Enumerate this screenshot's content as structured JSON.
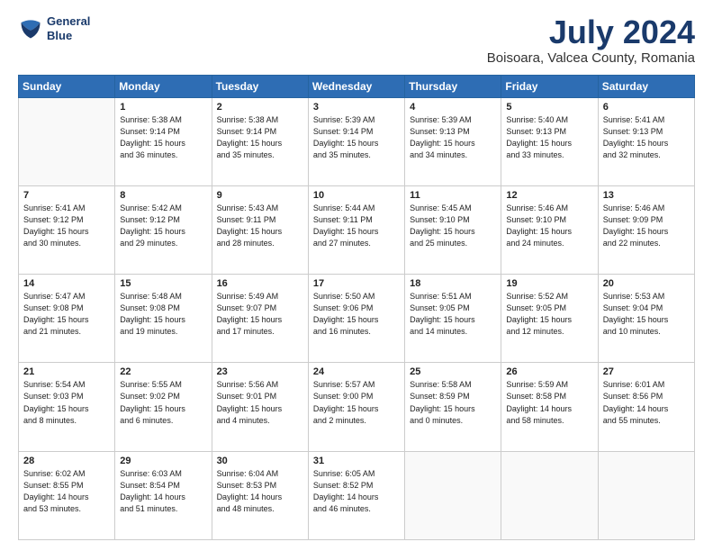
{
  "header": {
    "logo_line1": "General",
    "logo_line2": "Blue",
    "title": "July 2024",
    "subtitle": "Boisoara, Valcea County, Romania"
  },
  "weekdays": [
    "Sunday",
    "Monday",
    "Tuesday",
    "Wednesday",
    "Thursday",
    "Friday",
    "Saturday"
  ],
  "weeks": [
    [
      {
        "day": "",
        "info": ""
      },
      {
        "day": "1",
        "info": "Sunrise: 5:38 AM\nSunset: 9:14 PM\nDaylight: 15 hours\nand 36 minutes."
      },
      {
        "day": "2",
        "info": "Sunrise: 5:38 AM\nSunset: 9:14 PM\nDaylight: 15 hours\nand 35 minutes."
      },
      {
        "day": "3",
        "info": "Sunrise: 5:39 AM\nSunset: 9:14 PM\nDaylight: 15 hours\nand 35 minutes."
      },
      {
        "day": "4",
        "info": "Sunrise: 5:39 AM\nSunset: 9:13 PM\nDaylight: 15 hours\nand 34 minutes."
      },
      {
        "day": "5",
        "info": "Sunrise: 5:40 AM\nSunset: 9:13 PM\nDaylight: 15 hours\nand 33 minutes."
      },
      {
        "day": "6",
        "info": "Sunrise: 5:41 AM\nSunset: 9:13 PM\nDaylight: 15 hours\nand 32 minutes."
      }
    ],
    [
      {
        "day": "7",
        "info": "Sunrise: 5:41 AM\nSunset: 9:12 PM\nDaylight: 15 hours\nand 30 minutes."
      },
      {
        "day": "8",
        "info": "Sunrise: 5:42 AM\nSunset: 9:12 PM\nDaylight: 15 hours\nand 29 minutes."
      },
      {
        "day": "9",
        "info": "Sunrise: 5:43 AM\nSunset: 9:11 PM\nDaylight: 15 hours\nand 28 minutes."
      },
      {
        "day": "10",
        "info": "Sunrise: 5:44 AM\nSunset: 9:11 PM\nDaylight: 15 hours\nand 27 minutes."
      },
      {
        "day": "11",
        "info": "Sunrise: 5:45 AM\nSunset: 9:10 PM\nDaylight: 15 hours\nand 25 minutes."
      },
      {
        "day": "12",
        "info": "Sunrise: 5:46 AM\nSunset: 9:10 PM\nDaylight: 15 hours\nand 24 minutes."
      },
      {
        "day": "13",
        "info": "Sunrise: 5:46 AM\nSunset: 9:09 PM\nDaylight: 15 hours\nand 22 minutes."
      }
    ],
    [
      {
        "day": "14",
        "info": "Sunrise: 5:47 AM\nSunset: 9:08 PM\nDaylight: 15 hours\nand 21 minutes."
      },
      {
        "day": "15",
        "info": "Sunrise: 5:48 AM\nSunset: 9:08 PM\nDaylight: 15 hours\nand 19 minutes."
      },
      {
        "day": "16",
        "info": "Sunrise: 5:49 AM\nSunset: 9:07 PM\nDaylight: 15 hours\nand 17 minutes."
      },
      {
        "day": "17",
        "info": "Sunrise: 5:50 AM\nSunset: 9:06 PM\nDaylight: 15 hours\nand 16 minutes."
      },
      {
        "day": "18",
        "info": "Sunrise: 5:51 AM\nSunset: 9:05 PM\nDaylight: 15 hours\nand 14 minutes."
      },
      {
        "day": "19",
        "info": "Sunrise: 5:52 AM\nSunset: 9:05 PM\nDaylight: 15 hours\nand 12 minutes."
      },
      {
        "day": "20",
        "info": "Sunrise: 5:53 AM\nSunset: 9:04 PM\nDaylight: 15 hours\nand 10 minutes."
      }
    ],
    [
      {
        "day": "21",
        "info": "Sunrise: 5:54 AM\nSunset: 9:03 PM\nDaylight: 15 hours\nand 8 minutes."
      },
      {
        "day": "22",
        "info": "Sunrise: 5:55 AM\nSunset: 9:02 PM\nDaylight: 15 hours\nand 6 minutes."
      },
      {
        "day": "23",
        "info": "Sunrise: 5:56 AM\nSunset: 9:01 PM\nDaylight: 15 hours\nand 4 minutes."
      },
      {
        "day": "24",
        "info": "Sunrise: 5:57 AM\nSunset: 9:00 PM\nDaylight: 15 hours\nand 2 minutes."
      },
      {
        "day": "25",
        "info": "Sunrise: 5:58 AM\nSunset: 8:59 PM\nDaylight: 15 hours\nand 0 minutes."
      },
      {
        "day": "26",
        "info": "Sunrise: 5:59 AM\nSunset: 8:58 PM\nDaylight: 14 hours\nand 58 minutes."
      },
      {
        "day": "27",
        "info": "Sunrise: 6:01 AM\nSunset: 8:56 PM\nDaylight: 14 hours\nand 55 minutes."
      }
    ],
    [
      {
        "day": "28",
        "info": "Sunrise: 6:02 AM\nSunset: 8:55 PM\nDaylight: 14 hours\nand 53 minutes."
      },
      {
        "day": "29",
        "info": "Sunrise: 6:03 AM\nSunset: 8:54 PM\nDaylight: 14 hours\nand 51 minutes."
      },
      {
        "day": "30",
        "info": "Sunrise: 6:04 AM\nSunset: 8:53 PM\nDaylight: 14 hours\nand 48 minutes."
      },
      {
        "day": "31",
        "info": "Sunrise: 6:05 AM\nSunset: 8:52 PM\nDaylight: 14 hours\nand 46 minutes."
      },
      {
        "day": "",
        "info": ""
      },
      {
        "day": "",
        "info": ""
      },
      {
        "day": "",
        "info": ""
      }
    ]
  ]
}
